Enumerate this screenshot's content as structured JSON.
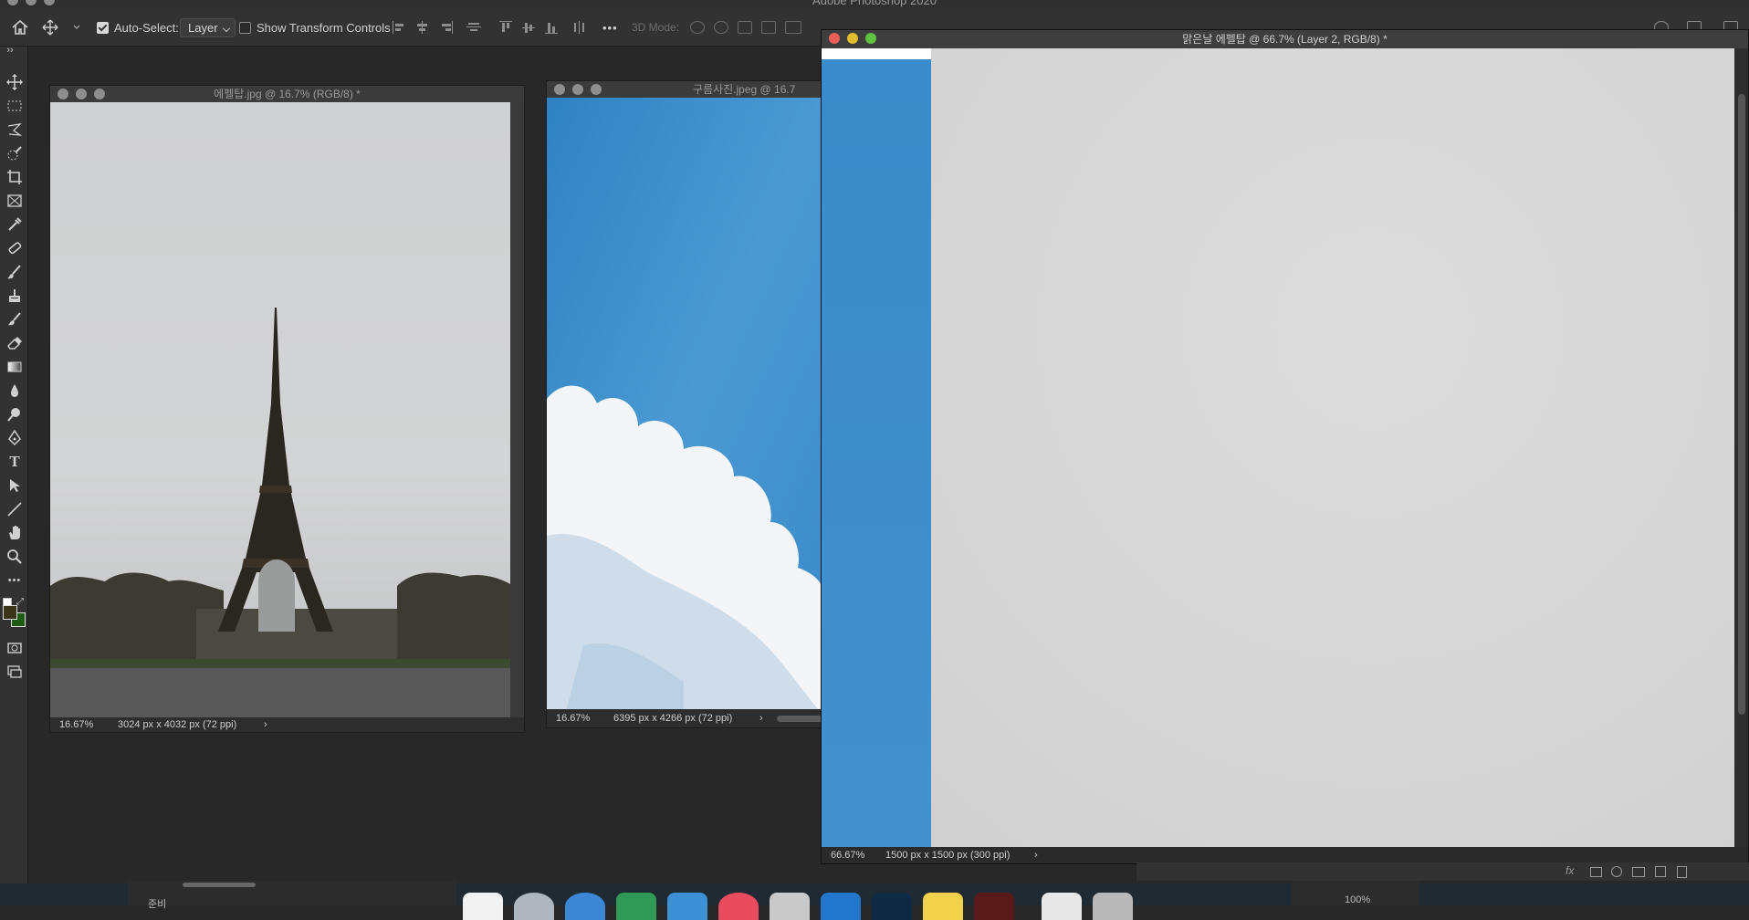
{
  "app": {
    "title": "Adobe Photoshop 2020"
  },
  "options_bar": {
    "auto_select_label": "Auto-Select:",
    "auto_select_checked": true,
    "layer_select_value": "Layer",
    "show_transform_label": "Show Transform Controls",
    "show_transform_checked": false,
    "three_d_mode_label": "3D Mode:",
    "more_label": "•••"
  },
  "toolbar": {
    "more_label": "•••",
    "foreground_color": "#3a3419",
    "background_color": "#1f5a12"
  },
  "documents": [
    {
      "title": "에펠탑.jpg @ 16.7% (RGB/8) *",
      "zoom": "16.67%",
      "info": "3024 px x 4032 px (72 ppi)",
      "arrow": "›"
    },
    {
      "title": "구름사진.jpeg @ 16.7",
      "zoom": "16.67%",
      "info": "6395 px x 4266 px (72 ppi)",
      "arrow": "›"
    },
    {
      "title": "맑은날 에펠탑 @ 66.7% (Layer 2, RGB/8) *",
      "zoom": "66.67%",
      "info": "1500 px x 1500 px (300 ppi)",
      "arrow": "›"
    }
  ],
  "bottom": {
    "status_fragment": "준비",
    "zoom_fragment": "100%"
  },
  "colors": {
    "panel_bg": "#323232",
    "workspace_bg": "#282828",
    "close_red": "#ec5f57",
    "minimize_yellow": "#e2bd2c",
    "zoom_green": "#5fc33f",
    "sky_blue": "#3d8fcc"
  }
}
